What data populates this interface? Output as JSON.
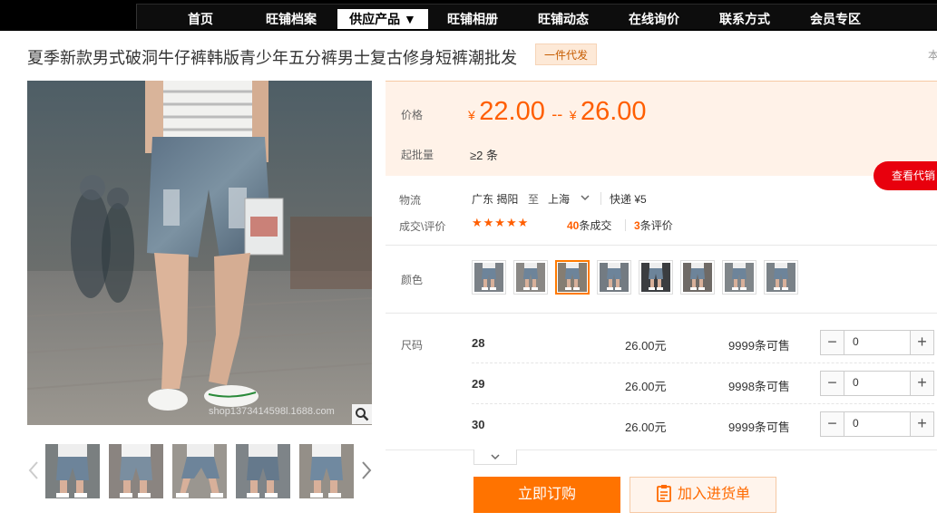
{
  "nav": {
    "items": [
      {
        "label": "首页"
      },
      {
        "label": "旺铺档案"
      },
      {
        "label": "供应产品 ▼"
      },
      {
        "label": "旺铺相册"
      },
      {
        "label": "旺铺动态"
      },
      {
        "label": "在线询价"
      },
      {
        "label": "联系方式"
      },
      {
        "label": "会员专区"
      }
    ],
    "active_index": 2
  },
  "product": {
    "title": "夏季新款男式破洞牛仔裤韩版青少年五分裤男士复古修身短裤潮批发",
    "badge": "一件代发",
    "edge_text": "本",
    "image_watermark": "shop1373414598l.1688.com"
  },
  "price": {
    "label": "价格",
    "currency": "¥",
    "low": "22.00",
    "sep": "--",
    "high": "26.00",
    "moq_label": "起批量",
    "moq_value": "≥2 条",
    "agent_button": "查看代销"
  },
  "logistics": {
    "label": "物流",
    "from": "广东 揭阳",
    "to_word": "至",
    "to": "上海",
    "express": "快递 ¥5"
  },
  "deals": {
    "label": "成交\\评价",
    "stars": "★★★★★",
    "rating": 5,
    "deal_count": "40",
    "deal_suffix": "条成交",
    "review_count": "3",
    "review_suffix": "条评价"
  },
  "color": {
    "label": "颜色",
    "selected_index": 2
  },
  "sizes": {
    "label": "尺码",
    "rows": [
      {
        "size": "28",
        "price": "26.00元",
        "stock": "9999条可售",
        "qty": "0"
      },
      {
        "size": "29",
        "price": "26.00元",
        "stock": "9998条可售",
        "qty": "0"
      },
      {
        "size": "30",
        "price": "26.00元",
        "stock": "9999条可售",
        "qty": "0"
      }
    ]
  },
  "actions": {
    "order": "立即订购",
    "cart": "加入进货单"
  },
  "colors": {
    "accent": "#ff5e00",
    "button_orange": "#ff7300",
    "agent_red": "#e8000d",
    "price_bg": "#fff2e8"
  }
}
